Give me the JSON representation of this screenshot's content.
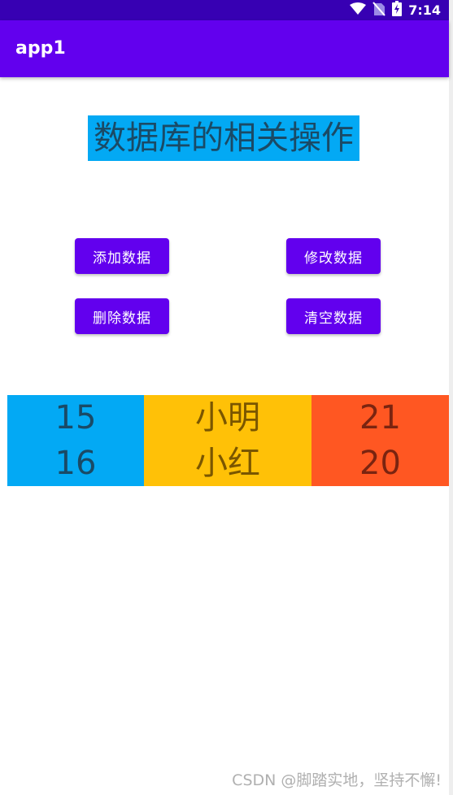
{
  "status_bar": {
    "time": "7:14",
    "icons": [
      "wifi-icon",
      "no-sim-icon",
      "battery-charging-icon"
    ]
  },
  "app_bar": {
    "title": "app1"
  },
  "page": {
    "title": "数据库的相关操作"
  },
  "buttons": {
    "add": "添加数据",
    "edit": "修改数据",
    "delete": "删除数据",
    "clear": "清空数据"
  },
  "records": {
    "ids": [
      "15",
      "16"
    ],
    "names": [
      "小明",
      "小红"
    ],
    "ages": [
      "21",
      "20"
    ]
  },
  "watermark": "CSDN @脚踏实地，坚持不懈!",
  "colors": {
    "status_bar": "#3700b3",
    "app_bar": "#6200ee",
    "button": "#6200ee",
    "title_bg": "#03a9f4",
    "id_column": "#03a9f4",
    "name_column": "#ffc107",
    "age_column": "#ff5722"
  }
}
